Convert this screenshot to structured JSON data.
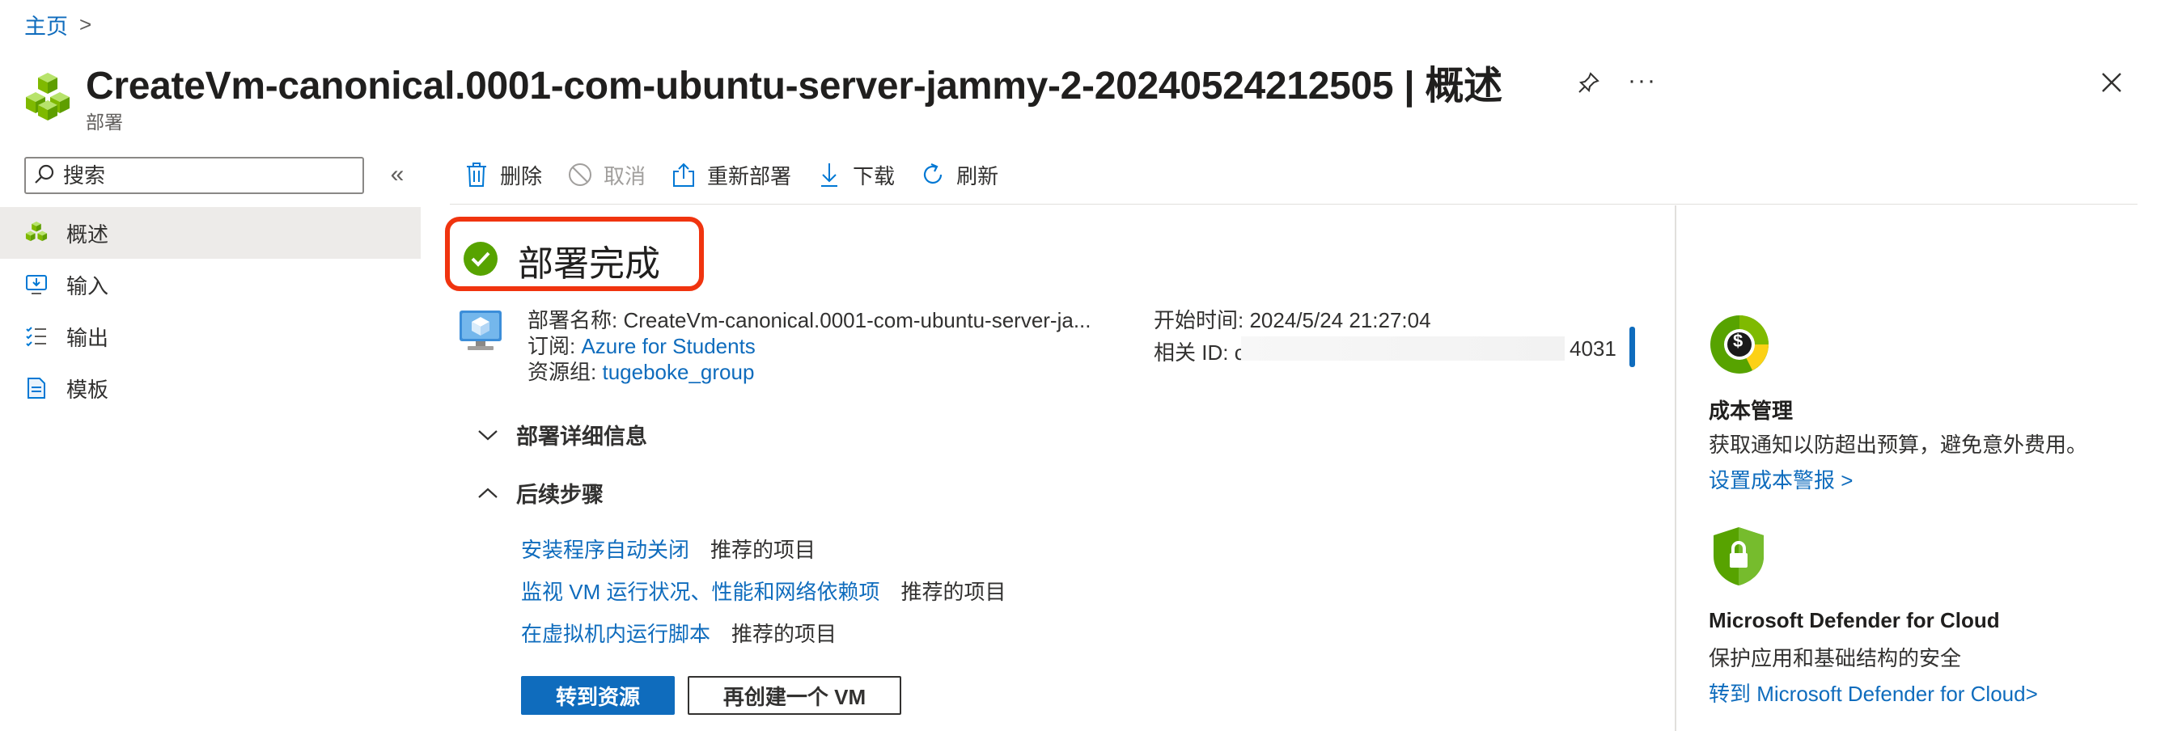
{
  "breadcrumb": {
    "home": "主页",
    "separator": ">"
  },
  "header": {
    "title": "CreateVm-canonical.0001-com-ubuntu-server-jammy-2-20240524212505 | 概述",
    "subtitle": "部署",
    "more": "···"
  },
  "sidebar": {
    "search_placeholder": "搜索",
    "collapse": "«",
    "items": [
      {
        "label": "概述",
        "icon": "deployment-cubes-icon",
        "active": true
      },
      {
        "label": "输入",
        "icon": "input-icon",
        "active": false
      },
      {
        "label": "输出",
        "icon": "output-list-icon",
        "active": false
      },
      {
        "label": "模板",
        "icon": "template-icon",
        "active": false
      }
    ]
  },
  "toolbar": {
    "delete": "删除",
    "cancel": "取消",
    "redeploy": "重新部署",
    "download": "下载",
    "refresh": "刷新"
  },
  "status": {
    "text": "部署完成",
    "icon": "success-check-icon",
    "color": "#57a300",
    "highlight_color": "#f0340f"
  },
  "details": {
    "name_label": "部署名称:",
    "name_value": "CreateVm-canonical.0001-com-ubuntu-server-ja...",
    "subscription_label": "订阅:",
    "subscription_value": "Azure for Students",
    "resource_group_label": "资源组:",
    "resource_group_value": "tugeboke_group",
    "start_time_label": "开始时间:",
    "start_time_value": "2024/5/24 21:27:04",
    "correlation_label": "相关 ID:",
    "correlation_prefix": "c",
    "correlation_suffix": "4031"
  },
  "sections": {
    "details_header": "部署详细信息",
    "next_steps_header": "后续步骤"
  },
  "next_steps": [
    {
      "link": "安装程序自动关闭",
      "tag": "推荐的项目"
    },
    {
      "link": "监视 VM 运行状况、性能和网络依赖项",
      "tag": "推荐的项目"
    },
    {
      "link": "在虚拟机内运行脚本",
      "tag": "推荐的项目"
    }
  ],
  "buttons": {
    "go_to_resource": "转到资源",
    "create_another": "再创建一个 VM"
  },
  "cards": {
    "cost": {
      "title": "成本管理",
      "desc": "获取通知以防超出预算，避免意外费用。",
      "link": "设置成本警报 >",
      "icon": "cost-management-icon",
      "icon_symbol": "$"
    },
    "defender": {
      "title": "Microsoft Defender for Cloud",
      "desc": "保护应用和基础结构的安全",
      "link": "转到 Microsoft Defender for Cloud>",
      "icon": "defender-shield-icon"
    }
  },
  "colors": {
    "accent": "#0f6cbd",
    "text": "#323130",
    "success": "#57a300"
  }
}
